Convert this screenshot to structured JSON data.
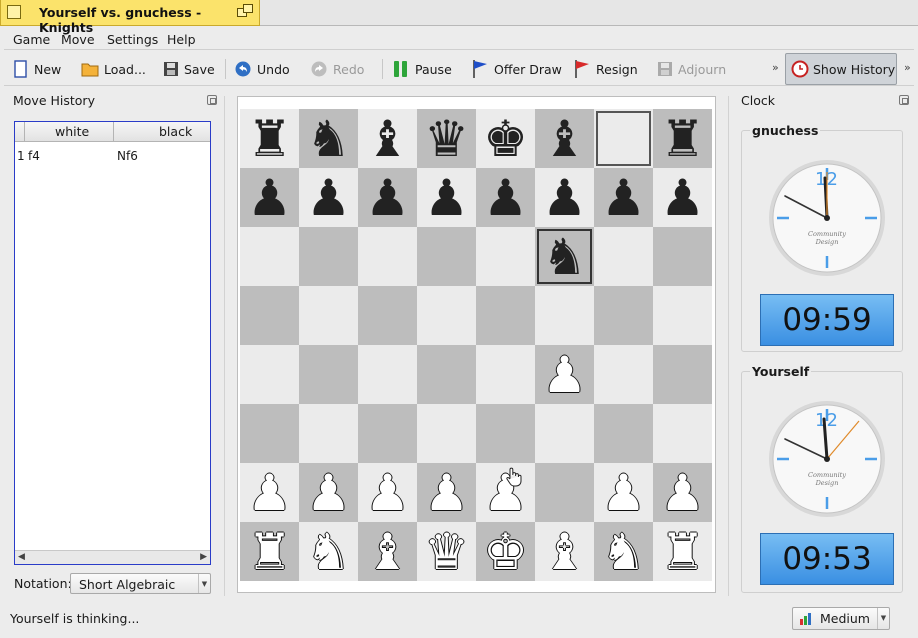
{
  "window": {
    "title": "Yourself vs. gnuchess - Knights"
  },
  "menu": {
    "items": [
      "Game",
      "Move",
      "Settings",
      "Help"
    ]
  },
  "toolbar": {
    "new": "New",
    "load": "Load...",
    "save": "Save",
    "undo": "Undo",
    "redo": "Redo",
    "pause": "Pause",
    "offer_draw": "Offer Draw",
    "resign": "Resign",
    "adjourn": "Adjourn",
    "show_history": "Show History",
    "more": "»"
  },
  "move_history": {
    "title": "Move History",
    "columns": [
      "white",
      "black"
    ],
    "rows": [
      {
        "num": "1",
        "white": "f4",
        "black": "Nf6"
      }
    ],
    "notation_label": "Notation:",
    "notation_value": "Short Algebraic"
  },
  "board": {
    "squares": [
      [
        "br",
        "bn",
        "bb",
        "bq",
        "bk",
        "bb",
        "",
        "br"
      ],
      [
        "bp",
        "bp",
        "bp",
        "bp",
        "bp",
        "bp",
        "bp",
        "bp"
      ],
      [
        "",
        "",
        "",
        "",
        "",
        "bn",
        "",
        ""
      ],
      [
        "",
        "",
        "",
        "",
        "",
        "",
        "",
        ""
      ],
      [
        "",
        "",
        "",
        "",
        "",
        "wp",
        "",
        ""
      ],
      [
        "",
        "",
        "",
        "",
        "",
        "",
        "",
        ""
      ],
      [
        "wp",
        "wp",
        "wp",
        "wp",
        "wp",
        "",
        "wp",
        "wp"
      ],
      [
        "wr",
        "wn",
        "wb",
        "wq",
        "wk",
        "wb",
        "wn",
        "wr"
      ]
    ],
    "last_move_from": [
      0,
      6
    ],
    "last_move_to": [
      2,
      5
    ],
    "glyphs": {
      "k": "♚",
      "q": "♛",
      "r": "♜",
      "b": "♝",
      "n": "♞",
      "p": "♟"
    }
  },
  "clock": {
    "title": "Clock",
    "players": [
      {
        "name": "gnuchess",
        "time": "09:59",
        "brand_line1": "Community",
        "brand_line2": "Design"
      },
      {
        "name": "Yourself",
        "time": "09:53",
        "brand_line1": "Community",
        "brand_line2": "Design"
      }
    ],
    "twelve": "12"
  },
  "status": {
    "text": "Yourself is thinking...",
    "difficulty": "Medium"
  },
  "colors": {
    "title_tab": "#fbe36b",
    "clock_digital": "#4a9de8",
    "selection_border": "#2a3cc8"
  }
}
